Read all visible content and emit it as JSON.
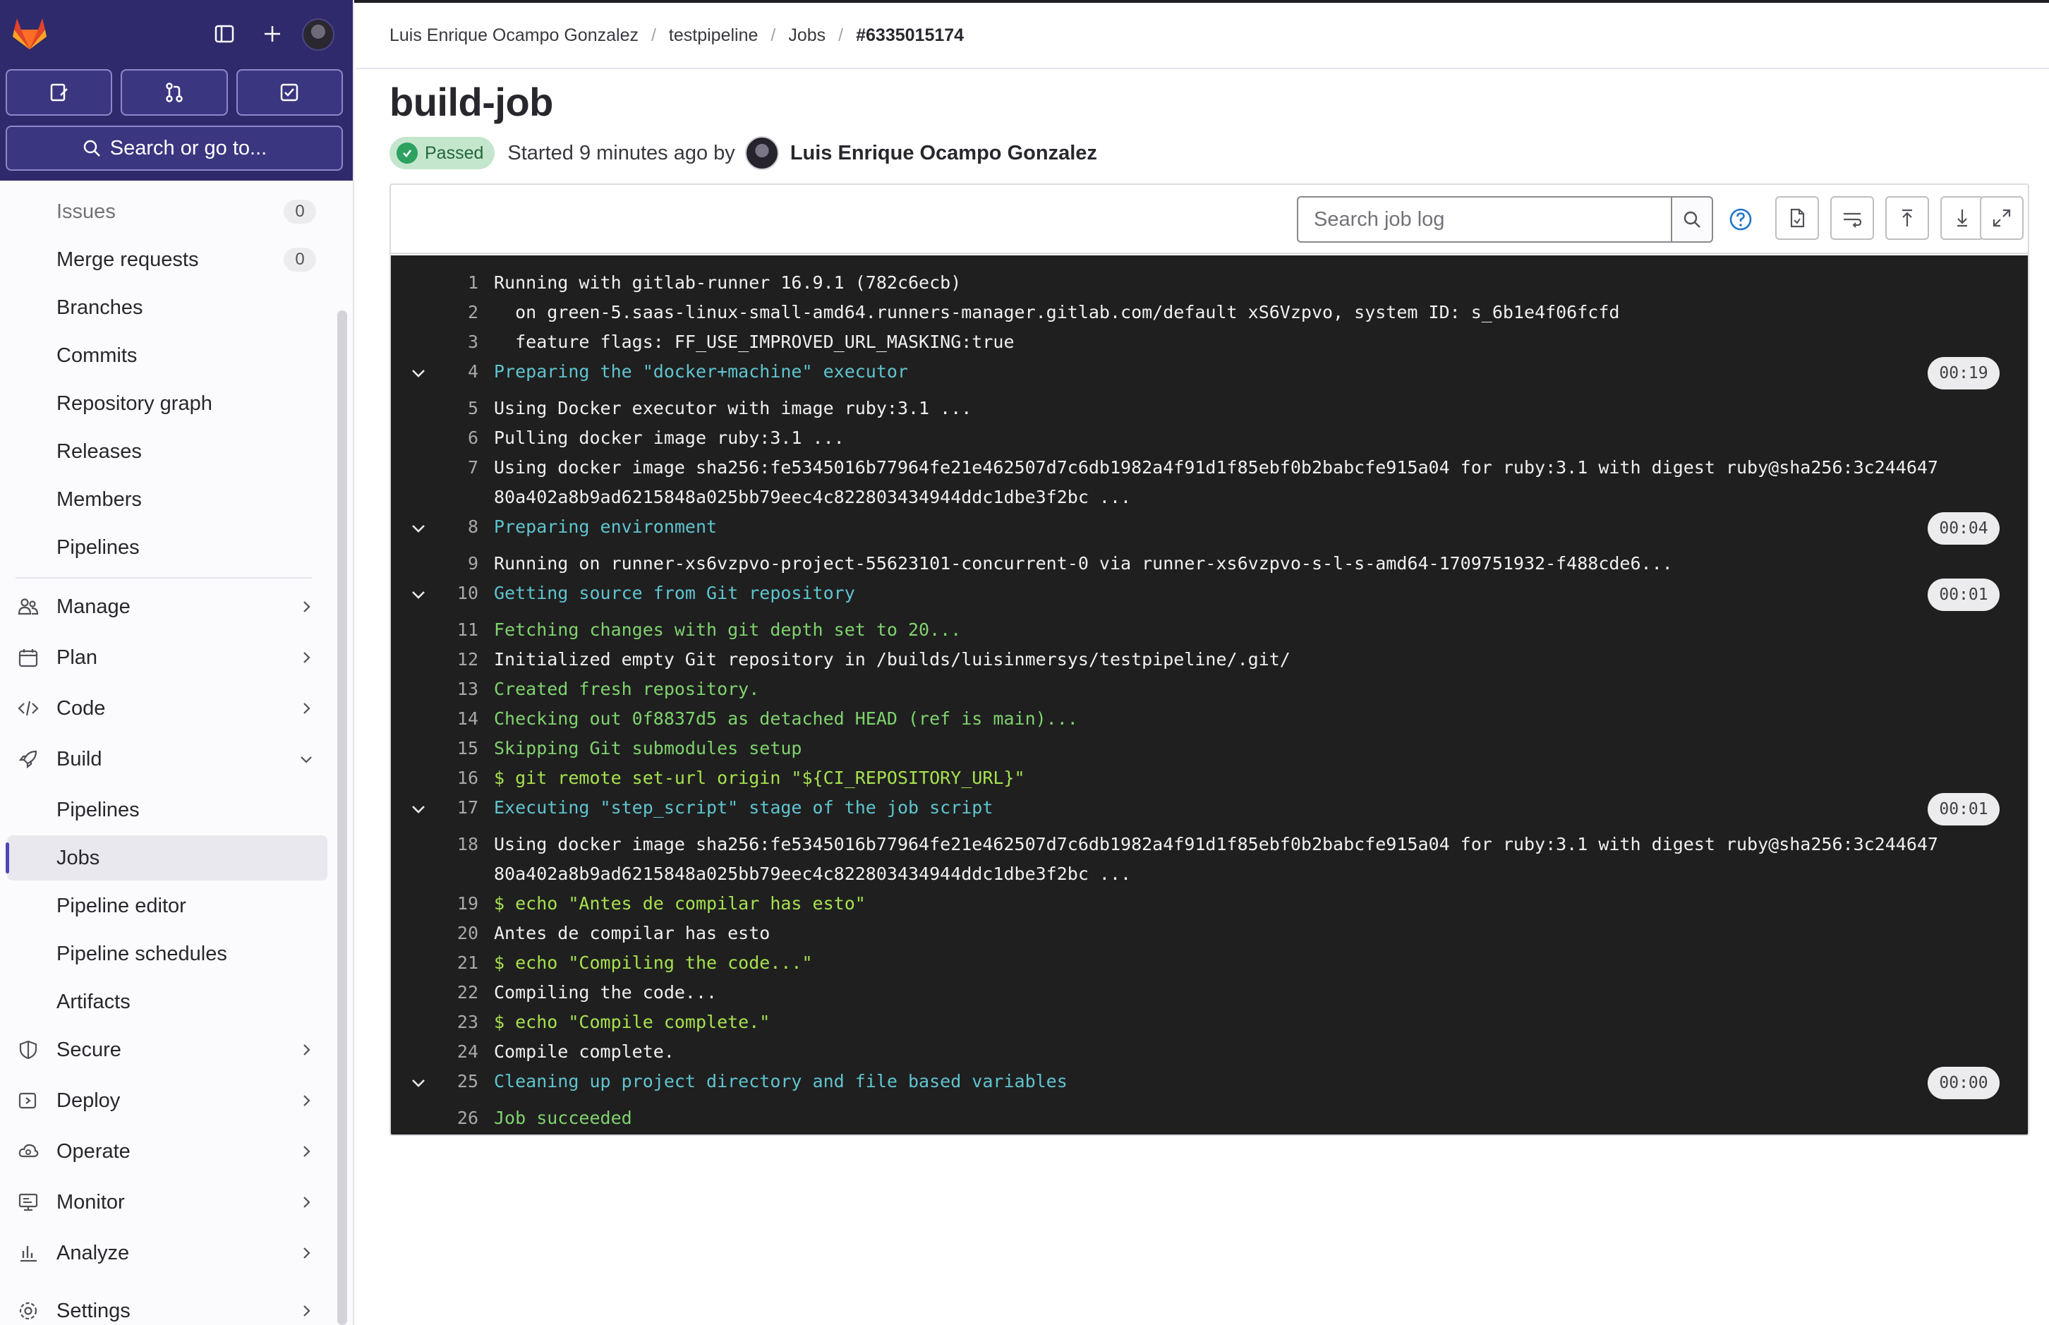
{
  "sidebar": {
    "search_label": "Search or go to...",
    "items": [
      {
        "label": "Issues",
        "count": "0"
      },
      {
        "label": "Merge requests",
        "count": "0"
      },
      {
        "label": "Branches"
      },
      {
        "label": "Commits"
      },
      {
        "label": "Repository graph"
      },
      {
        "label": "Releases"
      },
      {
        "label": "Members"
      },
      {
        "label": "Pipelines"
      }
    ],
    "sections": [
      {
        "label": "Manage",
        "icon": "users-icon"
      },
      {
        "label": "Plan",
        "icon": "calendar-icon"
      },
      {
        "label": "Code",
        "icon": "code-icon"
      },
      {
        "label": "Build",
        "icon": "rocket-icon"
      }
    ],
    "build_items": [
      {
        "label": "Pipelines"
      },
      {
        "label": "Jobs"
      },
      {
        "label": "Pipeline editor"
      },
      {
        "label": "Pipeline schedules"
      },
      {
        "label": "Artifacts"
      }
    ],
    "lower_sections": [
      {
        "label": "Secure",
        "icon": "shield-icon"
      },
      {
        "label": "Deploy",
        "icon": "deploy-icon"
      },
      {
        "label": "Operate",
        "icon": "cloud-icon"
      },
      {
        "label": "Monitor",
        "icon": "monitor-icon"
      },
      {
        "label": "Analyze",
        "icon": "chart-icon"
      },
      {
        "label": "Settings",
        "icon": "gear-icon"
      }
    ]
  },
  "breadcrumb": [
    "Luis Enrique Ocampo Gonzalez",
    "testpipeline",
    "Jobs",
    "#6335015174"
  ],
  "job": {
    "title": "build-job",
    "status": "Passed",
    "started": "Started 9 minutes ago by",
    "user": "Luis Enrique Ocampo Gonzalez"
  },
  "log_toolbar": {
    "search_placeholder": "Search job log"
  },
  "log": [
    {
      "n": "1",
      "t": "Running with gitlab-runner 16.9.1 (782c6ecb)",
      "c": ""
    },
    {
      "n": "2",
      "t": "  on green-5.saas-linux-small-amd64.runners-manager.gitlab.com/default xS6Vzpvo, system ID: s_6b1e4f06fcfd",
      "c": ""
    },
    {
      "n": "3",
      "t": "  feature flags: FF_USE_IMPROVED_URL_MASKING:true",
      "c": ""
    },
    {
      "n": "4",
      "t": "Preparing the \"docker+machine\" executor",
      "c": "cyan",
      "dur": "00:19"
    },
    {
      "n": "5",
      "t": "Using Docker executor with image ruby:3.1 ...",
      "c": ""
    },
    {
      "n": "6",
      "t": "Pulling docker image ruby:3.1 ...",
      "c": ""
    },
    {
      "n": "7",
      "t": "Using docker image sha256:fe5345016b77964fe21e462507d7c6db1982a4f91d1f85ebf0b2babcfe915a04 for ruby:3.1 with digest ruby@sha256:3c244647",
      "t2": "80a402a8b9ad6215848a025bb79eec4c822803434944ddc1dbe3f2bc ...",
      "c": ""
    },
    {
      "n": "8",
      "t": "Preparing environment",
      "c": "cyan",
      "dur": "00:04"
    },
    {
      "n": "9",
      "t": "Running on runner-xs6vzpvo-project-55623101-concurrent-0 via runner-xs6vzpvo-s-l-s-amd64-1709751932-f488cde6...",
      "c": ""
    },
    {
      "n": "10",
      "t": "Getting source from Git repository",
      "c": "cyan",
      "dur": "00:01"
    },
    {
      "n": "11",
      "t": "Fetching changes with git depth set to 20...",
      "c": "green"
    },
    {
      "n": "12",
      "t": "Initialized empty Git repository in /builds/luisinmersys/testpipeline/.git/",
      "c": ""
    },
    {
      "n": "13",
      "t": "Created fresh repository.",
      "c": "green"
    },
    {
      "n": "14",
      "t": "Checking out 0f8837d5 as detached HEAD (ref is main)...",
      "c": "green"
    },
    {
      "n": "15",
      "t": "Skipping Git submodules setup",
      "c": "green"
    },
    {
      "n": "16",
      "t": "$ git remote set-url origin \"${CI_REPOSITORY_URL}\"",
      "c": "lime"
    },
    {
      "n": "17",
      "t": "Executing \"step_script\" stage of the job script",
      "c": "cyan",
      "dur": "00:01"
    },
    {
      "n": "18",
      "t": "Using docker image sha256:fe5345016b77964fe21e462507d7c6db1982a4f91d1f85ebf0b2babcfe915a04 for ruby:3.1 with digest ruby@sha256:3c244647",
      "t2": "80a402a8b9ad6215848a025bb79eec4c822803434944ddc1dbe3f2bc ...",
      "c": ""
    },
    {
      "n": "19",
      "t": "$ echo \"Antes de compilar has esto\"",
      "c": "lime"
    },
    {
      "n": "20",
      "t": "Antes de compilar has esto",
      "c": ""
    },
    {
      "n": "21",
      "t": "$ echo \"Compiling the code...\"",
      "c": "lime"
    },
    {
      "n": "22",
      "t": "Compiling the code...",
      "c": ""
    },
    {
      "n": "23",
      "t": "$ echo \"Compile complete.\"",
      "c": "lime"
    },
    {
      "n": "24",
      "t": "Compile complete.",
      "c": ""
    },
    {
      "n": "25",
      "t": "Cleaning up project directory and file based variables",
      "c": "cyan",
      "dur": "00:00"
    },
    {
      "n": "26",
      "t": "Job succeeded",
      "c": "green"
    }
  ],
  "colors": {
    "sidebar_top": "#2f2a6b",
    "log_bg": "#1f1f1f",
    "section_header": "#5fc4cf",
    "success_text": "#7fd36e",
    "command_text": "#a6e14e",
    "badge_bg": "#c3e6cd"
  }
}
